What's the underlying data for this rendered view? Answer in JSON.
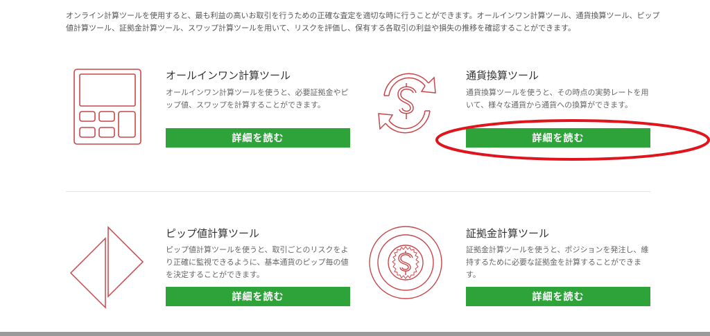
{
  "intro": "オンライン計算ツールを使用すると、最も利益の高いお取引を行うための正確な査定を適切な時に行うことができます。オールインワン計算ツール、通貨換算ツール、ピップ値計算ツール、証拠金計算ツール、スワップ計算ツールを用いて、リスクを評価し、保有する各取引の利益や損失の推移を確認することができます。",
  "tools": [
    {
      "icon": "calculator-icon",
      "title": "オールインワン計算ツール",
      "description": "オールインワン計算ツールを使うと、必要証拠金やピップ値、スワップを計算することができます。",
      "button": "詳細を読む"
    },
    {
      "icon": "currency-exchange-icon",
      "title": "通貨換算ツール",
      "description": "通貨換算ツールを使うと、その時点の実勢レートを用いて、様々な通貨から通貨への換算ができます。",
      "button": "詳細を読む"
    },
    {
      "icon": "pip-arrows-icon",
      "title": "ピップ値計算ツール",
      "description": "ピップ値計算ツールを使うと、取引ごとのリスクをより正確に監視できるように、基本通貨のピップ毎の値を決定することができます。",
      "button": "詳細を読む"
    },
    {
      "icon": "dollar-coin-icon",
      "title": "証拠金計算ツール",
      "description": "証拠金計算ツールを使うと、ポジションを発注し、維持するために必要な証拠金を計算することができます。",
      "button": "詳細を読む"
    }
  ],
  "colors": {
    "button": "#2ea33a",
    "icon_stroke": "#c9464b",
    "highlight": "#e0141c"
  }
}
